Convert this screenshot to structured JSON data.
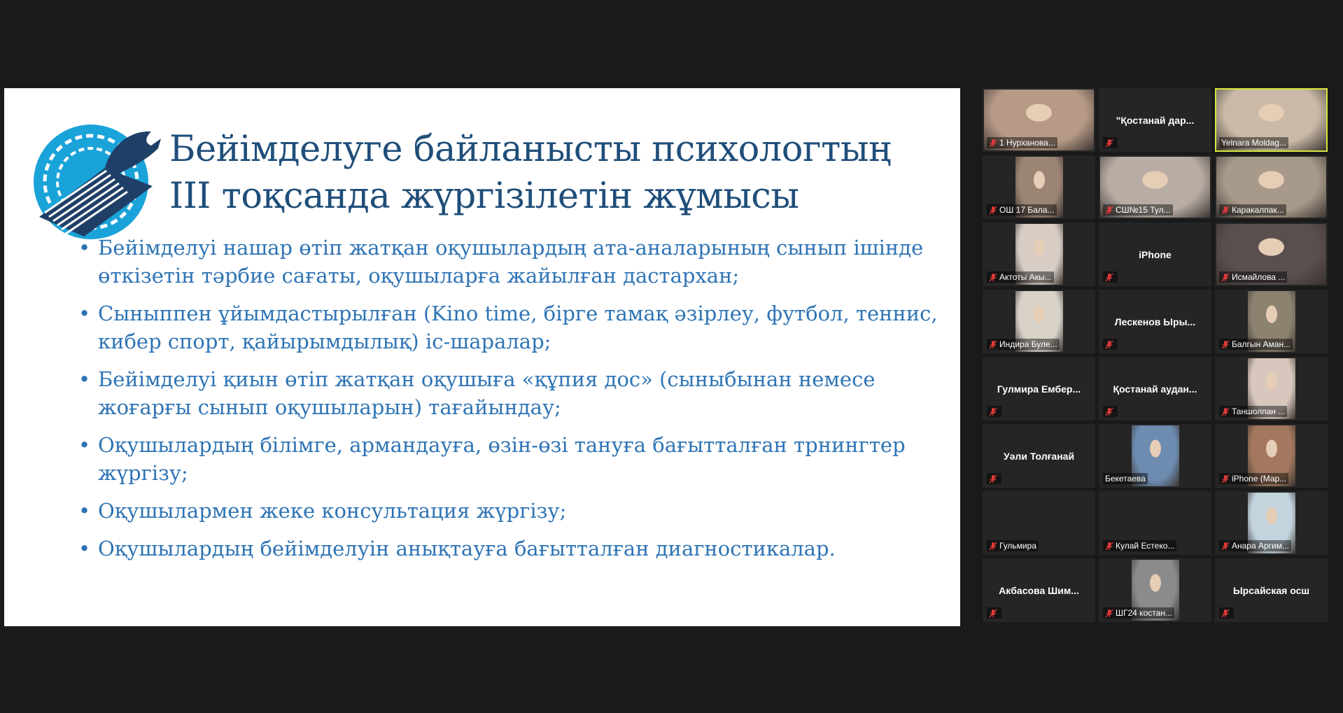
{
  "slide": {
    "title_lines": [
      "Бейімделуге байланысты психологтың",
      "ІІІ тоқсанда жүргізілетін жұмысы"
    ],
    "bullets": [
      "Бейімделуі нашар өтіп жатқан оқушылардың ата-аналарының сынып ішінде өткізетін тәрбие сағаты, оқушыларға жайылған дастархан;",
      "Сыныппен ұйымдастырылған (Kino time, бірге тамақ әзірлеу, футбол, теннис, кибер спорт, қайырымдылық) іс-шаралар;",
      "Бейімделуі қиын өтіп жатқан оқушыға «құпия дос» (сыныбынан немесе жоғарғы сынып оқушыларын) тағайындау;",
      "Оқушылардың білімге, армандауға, өзін-өзі тануға бағытталған трнингтер жүргізу;",
      "Оқушылармен жеке консультация жүргізу;",
      "Оқушылардың бейімделуін анықтауға бағытталған диагностикалар."
    ],
    "colors": {
      "title": "#1f4e79",
      "bullet": "#2e74b5"
    }
  },
  "participants": [
    {
      "label": "1 Нурханова...",
      "center": "",
      "video": "full",
      "tone": "#b79a86",
      "muted": true
    },
    {
      "label": "",
      "center": "\"Қостанай дар...",
      "video": "",
      "tone": "",
      "muted": true
    },
    {
      "label": "Yelnara Moldag...",
      "center": "",
      "video": "full",
      "tone": "#c9b9a6",
      "muted": false,
      "active": true
    },
    {
      "label": "ОШ 17 Бала...",
      "center": "",
      "video": "narrow",
      "tone": "#9c8474",
      "muted": true
    },
    {
      "label": "СШ№15 Тул...",
      "center": "",
      "video": "full",
      "tone": "#b8ada4",
      "muted": true
    },
    {
      "label": "Каракалпак...",
      "center": "",
      "video": "full",
      "tone": "#a89a8a",
      "muted": true
    },
    {
      "label": "Актоты Акы...",
      "center": "",
      "video": "narrow",
      "tone": "#d7cdc5",
      "muted": true
    },
    {
      "label": "",
      "center": "iPhone",
      "video": "",
      "tone": "",
      "muted": true
    },
    {
      "label": "Исмайлова ...",
      "center": "",
      "video": "full",
      "tone": "#5a4f4f",
      "muted": true
    },
    {
      "label": "Индира Буле...",
      "center": "",
      "video": "narrow",
      "tone": "#d8d2c9",
      "muted": true
    },
    {
      "label": "",
      "center": "Лескенов Ыры...",
      "video": "",
      "tone": "",
      "muted": true
    },
    {
      "label": "Балгын Аман...",
      "center": "",
      "video": "narrow",
      "tone": "#8c8270",
      "muted": true
    },
    {
      "label": "",
      "center": "Гулмира Ембер...",
      "video": "",
      "tone": "",
      "muted": true
    },
    {
      "label": "",
      "center": "Қостанай аудан...",
      "video": "",
      "tone": "",
      "muted": true
    },
    {
      "label": "Таншолпан ...",
      "center": "",
      "video": "narrow",
      "tone": "#d7c7bd",
      "muted": true
    },
    {
      "label": "",
      "center": "Уәли Толғанай",
      "video": "",
      "tone": "",
      "muted": true
    },
    {
      "label": "Бекетаева",
      "center": "",
      "video": "narrow",
      "tone": "#6d8cb0",
      "muted": false
    },
    {
      "label": "iPhone (Мар...",
      "center": "",
      "video": "narrow",
      "tone": "#a3785e",
      "muted": true
    },
    {
      "label": "Гульмира",
      "center": "",
      "video": "",
      "tone": "",
      "muted": true
    },
    {
      "label": "Кулай Естеко...",
      "center": "",
      "video": "",
      "tone": "",
      "muted": true
    },
    {
      "label": "Анара Аргим...",
      "center": "",
      "video": "narrow",
      "tone": "#c3d4df",
      "muted": true
    },
    {
      "label": "",
      "center": "Акбасова Шим...",
      "video": "",
      "tone": "",
      "muted": true
    },
    {
      "label": "ШГ24 костан...",
      "center": "",
      "video": "narrow",
      "tone": "#8b8b8b",
      "muted": true
    },
    {
      "label": "",
      "center": "Ырсайская осш",
      "video": "",
      "tone": "",
      "muted": true
    }
  ]
}
